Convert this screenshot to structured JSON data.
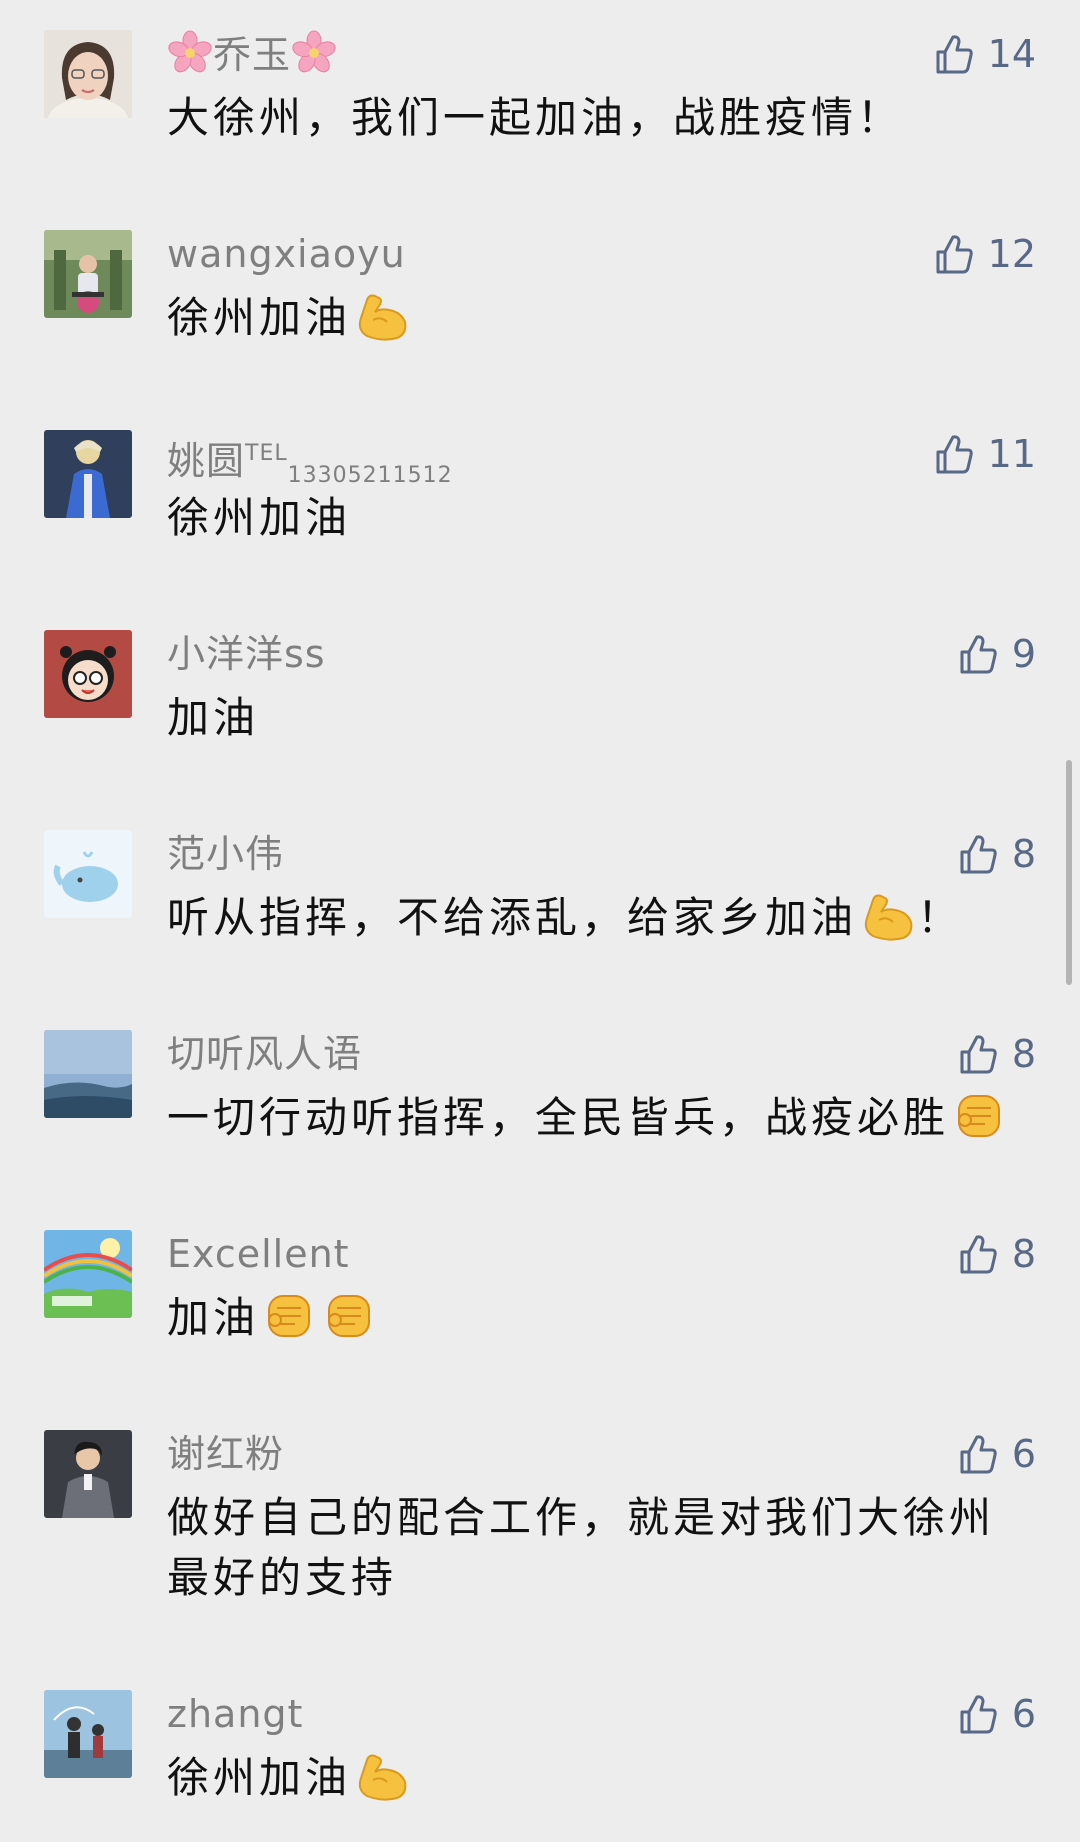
{
  "comments": [
    {
      "name": "乔玉",
      "text": "大徐州，我们一起加油，战胜疫情！",
      "likes": "14"
    },
    {
      "name": "wangxiaoyu",
      "text": "徐州加油",
      "likes": "12"
    },
    {
      "name": "姚圆",
      "name_tel": "TEL",
      "name_num": "13305211512",
      "text": "徐州加油",
      "likes": "11"
    },
    {
      "name": "小洋洋ss",
      "text": "加油",
      "likes": "9"
    },
    {
      "name": "范小伟",
      "text": "听从指挥，不给添乱，给家乡加油",
      "text_suffix": "！",
      "likes": "8"
    },
    {
      "name": "切听风人语",
      "text": "一切行动听指挥，全民皆兵，战疫必胜",
      "likes": "8"
    },
    {
      "name": "Excellent",
      "text": "加油",
      "likes": "8"
    },
    {
      "name": "谢红粉",
      "text": "做好自己的配合工作，就是对我们大徐州",
      "text_line2": "最好的支持",
      "likes": "6"
    },
    {
      "name": "zhangt",
      "text": "徐州加油",
      "likes": "6"
    }
  ],
  "icons": {
    "like": "thumbs-up-outline-icon",
    "flower": "cherry-blossom-icon",
    "muscle": "flexed-biceps-emoji",
    "fist": "raised-fist-emoji"
  },
  "colors": {
    "background": "#ededed",
    "username": "#7f7f7f",
    "like": "#586887",
    "text": "#111111"
  }
}
